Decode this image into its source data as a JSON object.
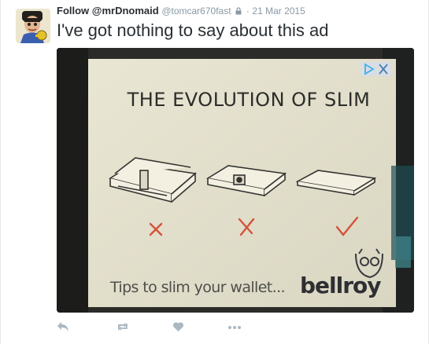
{
  "tweet": {
    "follow_label": "Follow @mrDnomaid",
    "handle": "@tomcar670fast",
    "separator": "·",
    "date": "21 Mar 2015",
    "text": "I've got nothing to say about this ad"
  },
  "ad": {
    "title": "THE EVOLUTION OF SLIM",
    "tagline": "Tips to slim your wallet...",
    "brand": "bellroy",
    "marks": [
      "cross",
      "cross",
      "check"
    ]
  },
  "colors": {
    "icon_gray": "#aab8c2",
    "mark_red": "#d5523a",
    "text_dark": "#292f33",
    "text_muted": "#8899a6",
    "adchoices_blue": "#3fb2e8"
  },
  "icons": [
    "avatar",
    "lock-icon",
    "reply-icon",
    "retweet-icon",
    "like-icon",
    "more-icon"
  ]
}
